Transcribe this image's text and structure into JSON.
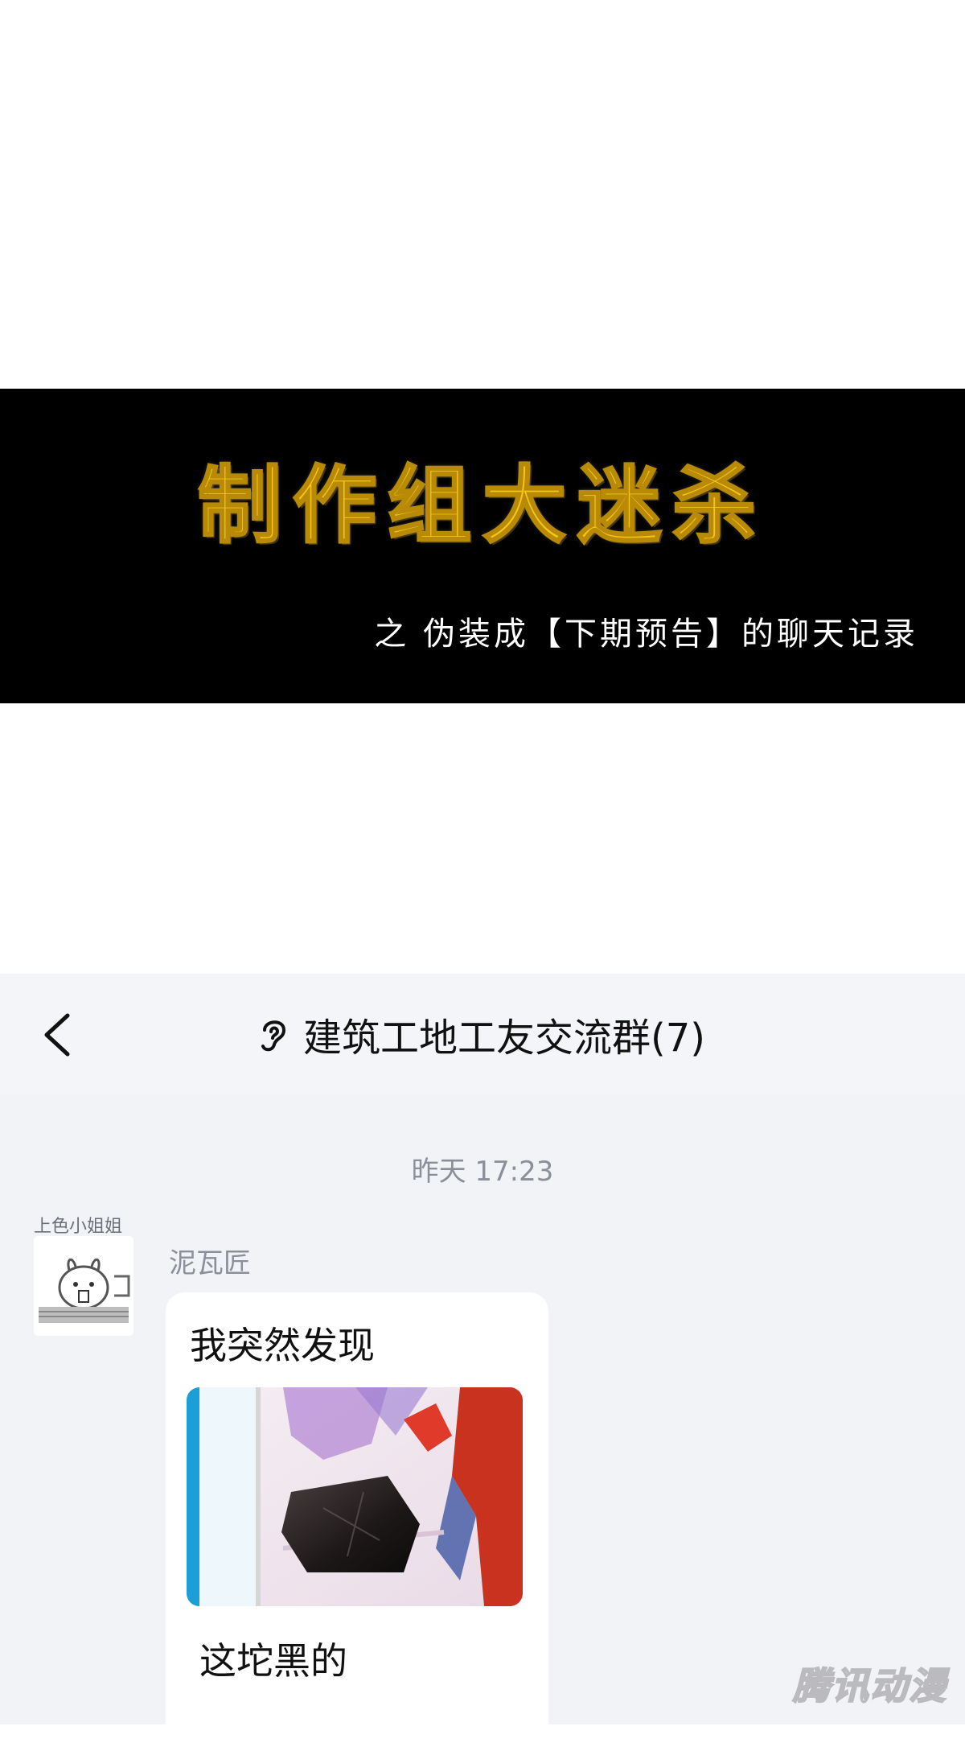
{
  "banner": {
    "title": "制作组大迷杀",
    "subtitle": "之 伪装成【下期预告】的聊天记录",
    "title_color": "#f7c51a"
  },
  "chat": {
    "header": {
      "back_icon": "chevron-left-icon",
      "mode_icon": "ear-icon",
      "title": "建筑工地工友交流群(7)"
    },
    "timestamp": "昨天 17:23",
    "message": {
      "avatar_label": "上色小姐姐",
      "sender": "泥瓦匠",
      "text_before": "我突然发现",
      "image": "black-block-image",
      "text_after": "这坨黑的"
    }
  },
  "watermark": "腾讯动漫",
  "colors": {
    "chat_background": "#f2f3f7",
    "header_background": "#f4f5f9",
    "bubble_background": "#ffffff",
    "meta_text": "#8b8f99"
  }
}
